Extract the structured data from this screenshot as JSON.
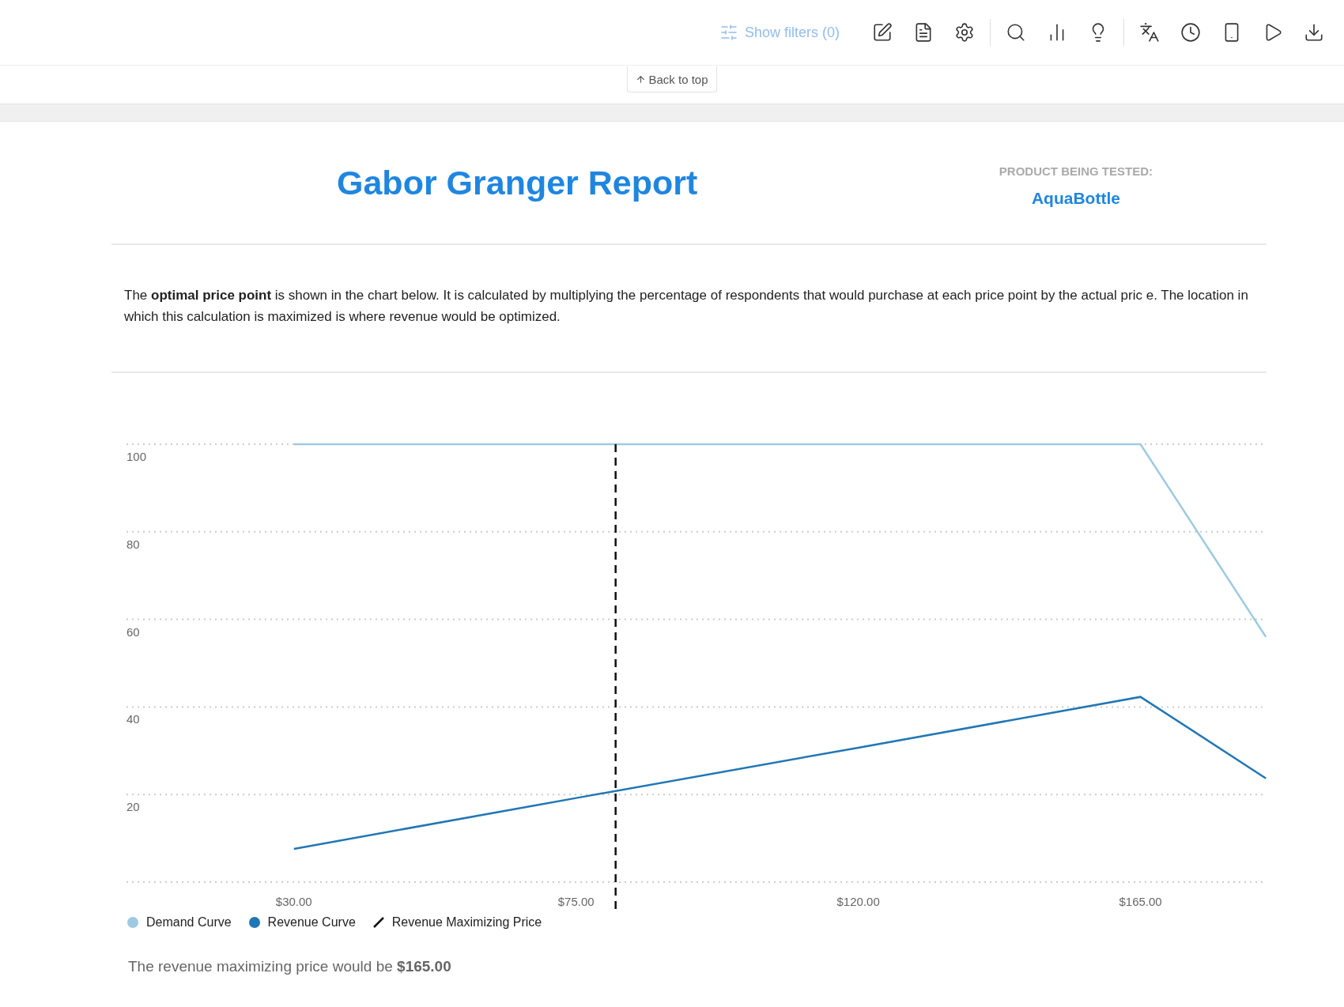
{
  "toolbar": {
    "filters_button": "Show filters (0)",
    "icons": [
      {
        "kind": "edit"
      },
      {
        "kind": "file-bulb"
      },
      {
        "kind": "settings"
      },
      {
        "kind": "separator"
      },
      {
        "kind": "text-search"
      },
      {
        "kind": "chart-search"
      },
      {
        "kind": "bulb"
      },
      {
        "kind": "separator"
      },
      {
        "kind": "translate"
      },
      {
        "kind": "clock"
      },
      {
        "kind": "phone"
      },
      {
        "kind": "play"
      },
      {
        "kind": "download"
      }
    ]
  },
  "back_to_top": "Back to top",
  "report": {
    "title": "Gabor Granger Report",
    "product_label": "PRODUCT BEING TESTED:",
    "product_name": "AquaBottle",
    "description": "The **optimal price point** is shown in the chart below. It is calculated by multiplying the percentage of respondents that would purchase at each price point by the actual pric e. The location in which this calculation is maximized is where revenue would be optimized.",
    "chart_data": {
      "type": "line",
      "x": [
        30,
        75,
        120,
        165,
        185
      ],
      "xlim": [
        3.3,
        185.1
      ],
      "ylim": [
        0,
        100
      ],
      "xticks": [
        {
          "value": 30,
          "label": "$30.00"
        },
        {
          "value": 75,
          "label": "$75.00"
        },
        {
          "value": 120,
          "label": "$120.00"
        },
        {
          "value": 165,
          "label": "$165.00"
        }
      ],
      "yticks": [
        20,
        40,
        60,
        80,
        100
      ],
      "series": [
        {
          "name": "Demand Curve",
          "color": "#9ecae1",
          "values": [
            100,
            100,
            100,
            100,
            56
          ]
        },
        {
          "name": "Revenue Curve",
          "color": "#2177b5",
          "values": [
            7.6,
            19.2,
            30.7,
            42.3,
            23.7
          ]
        }
      ],
      "grid": true,
      "ref_lines": [
        {
          "axis": "x",
          "value": 81.3,
          "label": "Revenue Maximizing Price"
        }
      ]
    },
    "summary": "The revenue maximizing price would be **$165.00**"
  }
}
